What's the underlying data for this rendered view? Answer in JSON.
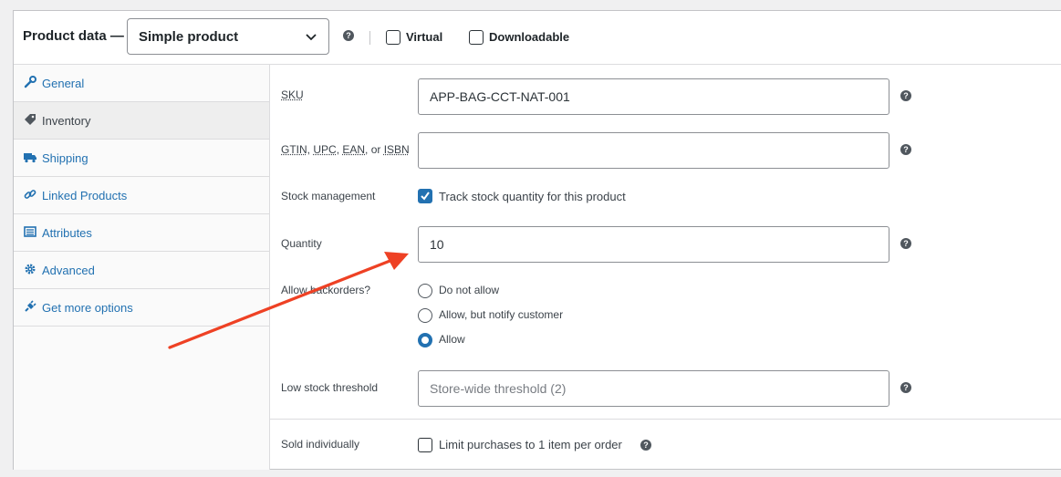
{
  "header": {
    "title": "Product data —",
    "product_type": "Simple product",
    "virtual_label": "Virtual",
    "downloadable_label": "Downloadable"
  },
  "sidebar": {
    "items": [
      {
        "label": "General",
        "icon": "wrench-icon"
      },
      {
        "label": "Inventory",
        "icon": "tag-icon"
      },
      {
        "label": "Shipping",
        "icon": "truck-icon"
      },
      {
        "label": "Linked Products",
        "icon": "link-icon"
      },
      {
        "label": "Attributes",
        "icon": "list-icon"
      },
      {
        "label": "Advanced",
        "icon": "gear-icon"
      },
      {
        "label": "Get more options",
        "icon": "plugin-icon"
      }
    ],
    "active": "Inventory"
  },
  "inventory": {
    "sku_label": "SKU",
    "sku_value": "APP-BAG-CCT-NAT-001",
    "gtin_label_parts": [
      "GTIN",
      "UPC",
      "EAN",
      "ISBN"
    ],
    "gtin_value": "",
    "stock_management_label": "Stock management",
    "track_stock_label": "Track stock quantity for this product",
    "track_stock_checked": true,
    "quantity_label": "Quantity",
    "quantity_value": "10",
    "backorders_label": "Allow backorders?",
    "backorder_options": [
      "Do not allow",
      "Allow, but notify customer",
      "Allow"
    ],
    "backorder_selected": "Allow",
    "low_stock_label": "Low stock threshold",
    "low_stock_placeholder": "Store-wide threshold (2)",
    "sold_individually_label": "Sold individually",
    "sold_individually_text": "Limit purchases to 1 item per order",
    "sold_individually_checked": false
  },
  "colors": {
    "accent": "#2271b1",
    "annotation_arrow": "#ee4124"
  }
}
